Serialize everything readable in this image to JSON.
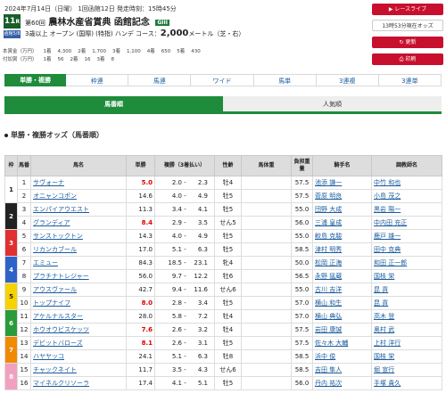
{
  "race": {
    "date_line": "2024年7月14日（日曜） 1回函館12日 発走時刻：15時45分",
    "number": "11",
    "number_suffix": "R",
    "title_prefix": "第60回",
    "title": "農林水産省賞典 函館記念",
    "grade": "GIII",
    "course_badge": "函館5/8",
    "cond_left": "3歳以上 オープン (国際) (特指) ハンデ コース：",
    "distance": "2,000",
    "cond_right": "メートル（芝・右）",
    "prize_row1": [
      "本賞金（万円）",
      "1着",
      "4,300",
      "2着",
      "1,700",
      "3着",
      "1,100",
      "4着",
      "650",
      "5着",
      "430"
    ],
    "prize_row2": [
      "付加賞（万円）",
      "1着",
      "56",
      "2着",
      "16",
      "3着",
      "8"
    ]
  },
  "side_buttons": {
    "live": "▶ レースライブ",
    "now": "13時53分現在オッズ",
    "update": "↻ 更新",
    "print": "⎙ 印刷"
  },
  "odds_tabs": [
    "単勝・複勝",
    "枠連",
    "馬連",
    "ワイド",
    "馬単",
    "3連複",
    "3連単"
  ],
  "sort_tabs": [
    "馬番順",
    "人気順"
  ],
  "section_title": "単勝・複勝オッズ（馬番順）",
  "table_headers": [
    "枠",
    "馬番",
    "馬名",
    "単勝",
    "複勝（3着払い）",
    "性齢",
    "馬体重",
    "負担重量",
    "騎手名",
    "調教師名"
  ],
  "waku_colors": {
    "1": "#ffffff",
    "2": "#222222",
    "3": "#e03030",
    "4": "#2f62c8",
    "5": "#f5d200",
    "6": "#2a9b3a",
    "7": "#f08a00",
    "8": "#f2a0c0"
  },
  "rows": [
    {
      "waku": "1",
      "num": "1",
      "name": "サヴォーナ",
      "tan": "5.0",
      "pop": true,
      "fuku_min": "2.0",
      "fuku_max": "2.3",
      "sex": "牡4",
      "wt": "",
      "kg": "57.5",
      "jockey": "池添 謙一",
      "trainer": "中竹 和也"
    },
    {
      "waku": "",
      "num": "2",
      "name": "オニャンコポン",
      "tan": "14.6",
      "pop": false,
      "fuku_min": "4.0",
      "fuku_max": "4.9",
      "sex": "牡5",
      "wt": "",
      "kg": "57.5",
      "jockey": "菅原 明良",
      "trainer": "小島 茂之"
    },
    {
      "waku": "2",
      "num": "3",
      "name": "エンパイアウエスト",
      "tan": "11.3",
      "pop": false,
      "fuku_min": "3.4",
      "fuku_max": "4.1",
      "sex": "牡5",
      "wt": "",
      "kg": "55.0",
      "jockey": "団野 大成",
      "trainer": "黒岩 陽一"
    },
    {
      "waku": "",
      "num": "4",
      "name": "グランディア",
      "tan": "8.4",
      "pop": true,
      "fuku_min": "2.9",
      "fuku_max": "3.5",
      "sex": "せん5",
      "wt": "",
      "kg": "56.0",
      "jockey": "三浦 皇成",
      "trainer": "中内田 充正"
    },
    {
      "waku": "3",
      "num": "5",
      "name": "サンストックトン",
      "tan": "14.3",
      "pop": false,
      "fuku_min": "4.0",
      "fuku_max": "4.9",
      "sex": "牡5",
      "wt": "",
      "kg": "55.0",
      "jockey": "鮫島 克駿",
      "trainer": "鹿戸 雄一"
    },
    {
      "waku": "",
      "num": "6",
      "name": "リカンカブール",
      "tan": "17.0",
      "pop": false,
      "fuku_min": "5.1",
      "fuku_max": "6.3",
      "sex": "牡5",
      "wt": "",
      "kg": "58.5",
      "jockey": "津村 明秀",
      "trainer": "田中 克典"
    },
    {
      "waku": "4",
      "num": "7",
      "name": "エミュー",
      "tan": "84.3",
      "pop": false,
      "fuku_min": "18.5",
      "fuku_max": "23.1",
      "sex": "牝4",
      "wt": "",
      "kg": "50.0",
      "jockey": "松岡 正海",
      "trainer": "和田 正一郎"
    },
    {
      "waku": "",
      "num": "8",
      "name": "プラチナトレジャー",
      "tan": "56.0",
      "pop": false,
      "fuku_min": "9.7",
      "fuku_max": "12.2",
      "sex": "牡6",
      "wt": "",
      "kg": "56.5",
      "jockey": "永野 猛蔵",
      "trainer": "国枝 栄"
    },
    {
      "waku": "5",
      "num": "9",
      "name": "アウスヴァール",
      "tan": "42.7",
      "pop": false,
      "fuku_min": "9.4",
      "fuku_max": "11.6",
      "sex": "せん6",
      "wt": "",
      "kg": "55.0",
      "jockey": "古川 吉洋",
      "trainer": "昆 貢"
    },
    {
      "waku": "",
      "num": "10",
      "name": "トップナイフ",
      "tan": "8.0",
      "pop": true,
      "fuku_min": "2.8",
      "fuku_max": "3.4",
      "sex": "牡5",
      "wt": "",
      "kg": "57.0",
      "jockey": "横山 和生",
      "trainer": "昆 貢"
    },
    {
      "waku": "6",
      "num": "11",
      "name": "アケルナルスター",
      "tan": "28.0",
      "pop": false,
      "fuku_min": "5.8",
      "fuku_max": "7.2",
      "sex": "牡4",
      "wt": "",
      "kg": "57.0",
      "jockey": "横山 典弘",
      "trainer": "高木 登"
    },
    {
      "waku": "",
      "num": "12",
      "name": "ホウオウビスケッツ",
      "tan": "7.6",
      "pop": true,
      "fuku_min": "2.6",
      "fuku_max": "3.2",
      "sex": "牡4",
      "wt": "",
      "kg": "57.5",
      "jockey": "岩田 康誠",
      "trainer": "奥村 武"
    },
    {
      "waku": "7",
      "num": "13",
      "name": "デビットバローズ",
      "tan": "8.1",
      "pop": true,
      "fuku_min": "2.6",
      "fuku_max": "3.1",
      "sex": "牡5",
      "wt": "",
      "kg": "57.5",
      "jockey": "佐々木 大輔",
      "trainer": "上村 洋行"
    },
    {
      "waku": "",
      "num": "14",
      "name": "ハヤヤッコ",
      "tan": "24.1",
      "pop": false,
      "fuku_min": "5.1",
      "fuku_max": "6.3",
      "sex": "牡8",
      "wt": "",
      "kg": "58.5",
      "jockey": "浜中 俊",
      "trainer": "国枝 栄"
    },
    {
      "waku": "8",
      "num": "15",
      "name": "チャックネイト",
      "tan": "11.7",
      "pop": false,
      "fuku_min": "3.5",
      "fuku_max": "4.3",
      "sex": "せん6",
      "wt": "",
      "kg": "58.5",
      "jockey": "吉田 隼人",
      "trainer": "堀 宣行"
    },
    {
      "waku": "",
      "num": "16",
      "name": "マイネルクリソーラ",
      "tan": "17.4",
      "pop": false,
      "fuku_min": "4.1",
      "fuku_max": "5.1",
      "sex": "牡5",
      "wt": "",
      "kg": "56.0",
      "jockey": "丹内 祐次",
      "trainer": "手塚 貴久"
    }
  ]
}
